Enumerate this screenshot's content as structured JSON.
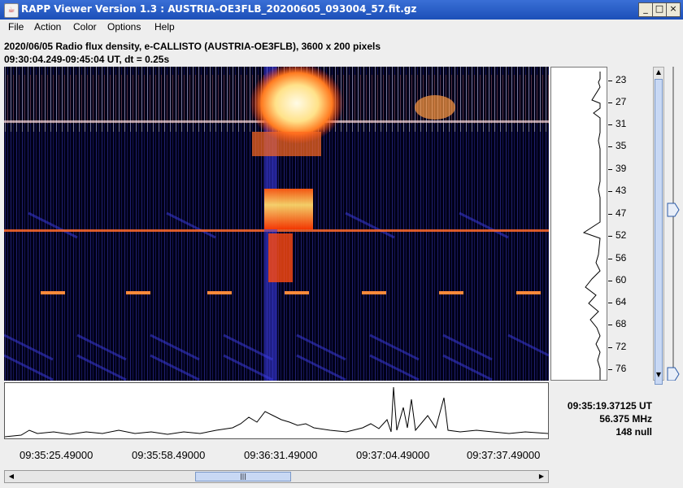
{
  "window": {
    "title": "RAPP Viewer Version 1.3 : AUSTRIA-OE3FLB_20200605_093004_57.fit.gz"
  },
  "menu": [
    "File",
    "Action",
    "Color",
    "Options",
    "Help"
  ],
  "info": {
    "line1": "2020/06/05  Radio flux density, e-CALLISTO (AUSTRIA-OE3FLB),  3600 x 200 pixels",
    "line2": "09:30:04.249-09:45:04 UT,  dt = 0.25s"
  },
  "freq_labels": [
    "23",
    "27",
    "31",
    "35",
    "39",
    "43",
    "47",
    "52",
    "56",
    "60",
    "64",
    "68",
    "72",
    "76"
  ],
  "time_labels": [
    "09:35:25.49000",
    "09:35:58.49000",
    "09:36:31.49000",
    "09:37:04.49000",
    "09:37:37.49000"
  ],
  "readout": {
    "time": "09:35:19.37125 UT",
    "freq": "56.375 MHz",
    "value": "148 null"
  },
  "colors": {
    "background": "#000018",
    "burst": "#ffe9a0",
    "band": "#ff6a2a"
  }
}
